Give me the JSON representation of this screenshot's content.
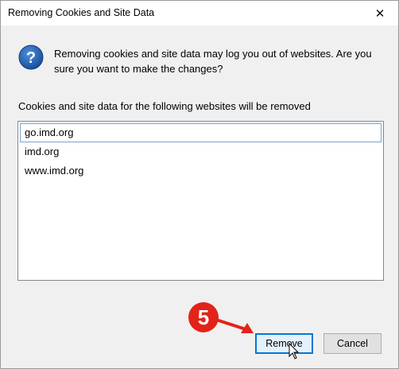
{
  "window": {
    "title": "Removing Cookies and Site Data",
    "close_glyph": "✕"
  },
  "dialog": {
    "icon": "question-icon",
    "message": "Removing cookies and site data may log you out of websites. Are you sure you want to make the changes?",
    "list_label": "Cookies and site data for the following websites will be removed",
    "sites": [
      "go.imd.org",
      "imd.org",
      "www.imd.org"
    ]
  },
  "buttons": {
    "remove_label": "Remove",
    "cancel_label": "Cancel"
  },
  "annotation": {
    "step_number": "5",
    "color": "#e2231a"
  },
  "colors": {
    "accent": "#0078d7",
    "icon_blue": "#1a5fb4"
  }
}
